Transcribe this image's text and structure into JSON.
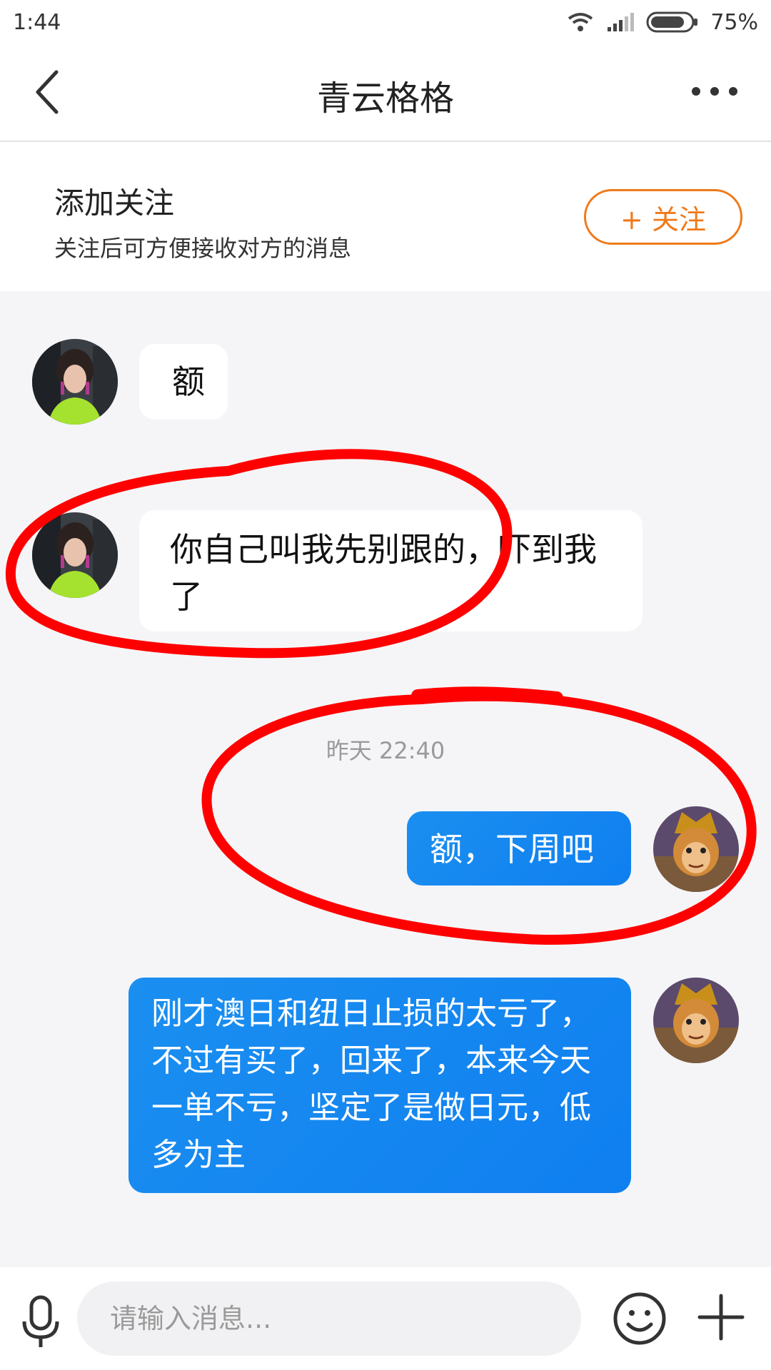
{
  "status_bar": {
    "time": "1:44",
    "battery": "75%"
  },
  "header": {
    "title": "青云格格"
  },
  "follow_banner": {
    "title": "添加关注",
    "subtitle": "关注后可方便接收对方的消息",
    "button_label": "+ 关注"
  },
  "messages": [
    {
      "side": "in",
      "text": "额"
    },
    {
      "side": "in",
      "text": "你自己叫我先别跟的，吓到我了"
    },
    {
      "timestamp": "昨天 22:40"
    },
    {
      "side": "out",
      "text": "额，下周吧"
    },
    {
      "side": "out",
      "text": "刚才澳日和纽日止损的太亏了，不过有买了，回来了，本来今天一单不亏，坚定了是做日元，低多为主"
    }
  ],
  "input_bar": {
    "placeholder": "请输入消息..."
  },
  "colors": {
    "accent_orange": "#f07a1a",
    "outgoing_bubble": "#1389f0",
    "annotation_red": "#ff0000"
  },
  "icons": [
    "back-arrow-icon",
    "more-dots-icon",
    "wifi-icon",
    "signal-icon",
    "battery-icon",
    "microphone-icon",
    "emoji-icon",
    "plus-icon"
  ]
}
